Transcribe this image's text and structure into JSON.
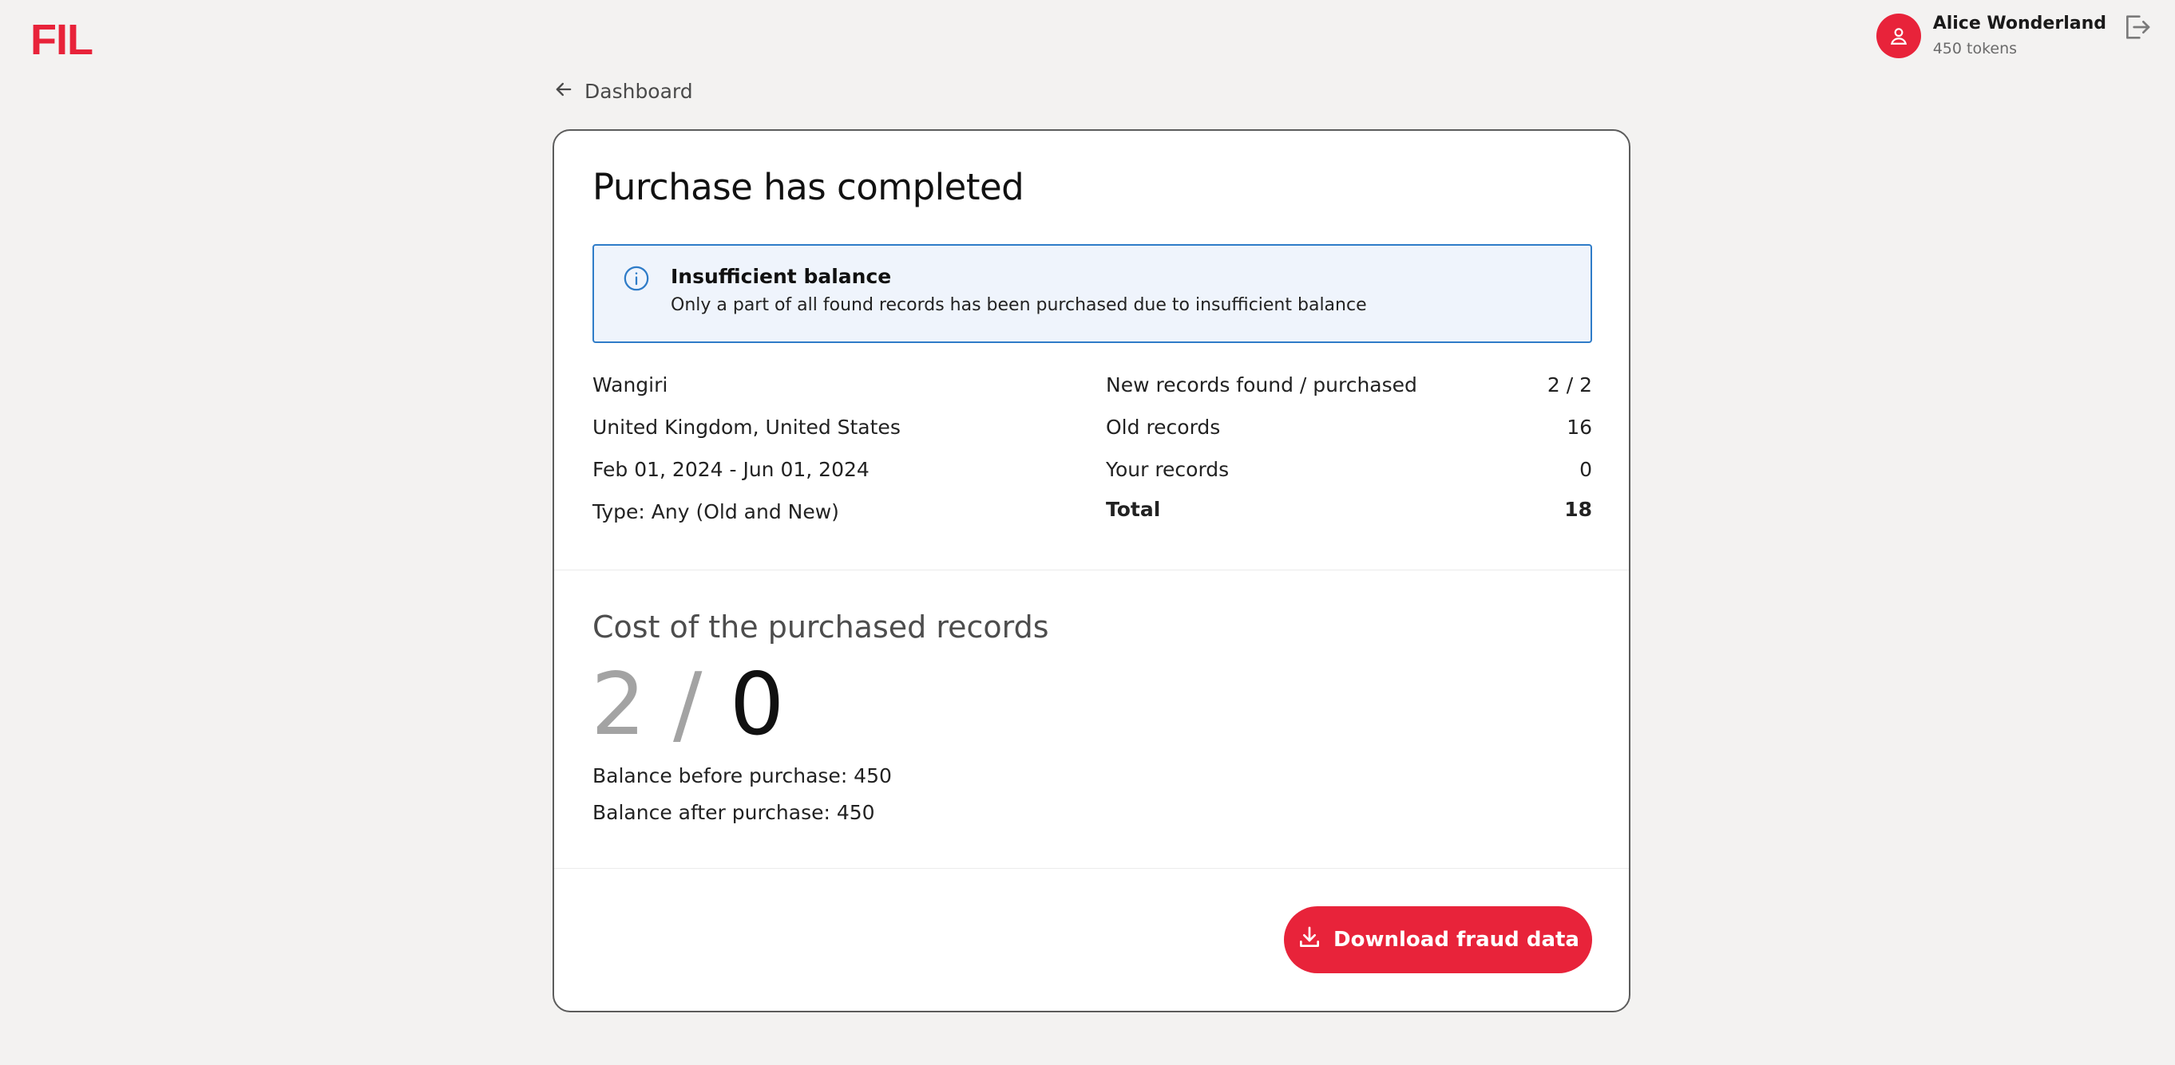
{
  "header": {
    "logo_text": "FIL",
    "user_name": "Alice Wonderland",
    "user_tokens": "450 tokens"
  },
  "nav": {
    "back_label": "Dashboard"
  },
  "card": {
    "title": "Purchase has completed",
    "alert": {
      "title": "Insufficient balance",
      "text": "Only a part of all found records has been purchased due to insufficient balance"
    },
    "criteria": [
      "Wangiri",
      "United Kingdom, United States",
      "Feb 01, 2024 - Jun 01, 2024",
      "Type: Any (Old and New)"
    ],
    "stats": [
      {
        "label": "New records found / purchased",
        "value": "2 / 2"
      },
      {
        "label": "Old records",
        "value": "16"
      },
      {
        "label": "Your records",
        "value": "0"
      },
      {
        "label": "Total",
        "value": "18"
      }
    ],
    "cost": {
      "title": "Cost of the purchased records",
      "value_primary": "2 /",
      "value_secondary": "0",
      "balance_before": "Balance before purchase: 450",
      "balance_after": "Balance after purchase: 450"
    },
    "download_label": "Download fraud data"
  },
  "colors": {
    "brand": "#e8233a",
    "alert_border": "#2f7cc8",
    "alert_bg": "#eff4fc"
  }
}
